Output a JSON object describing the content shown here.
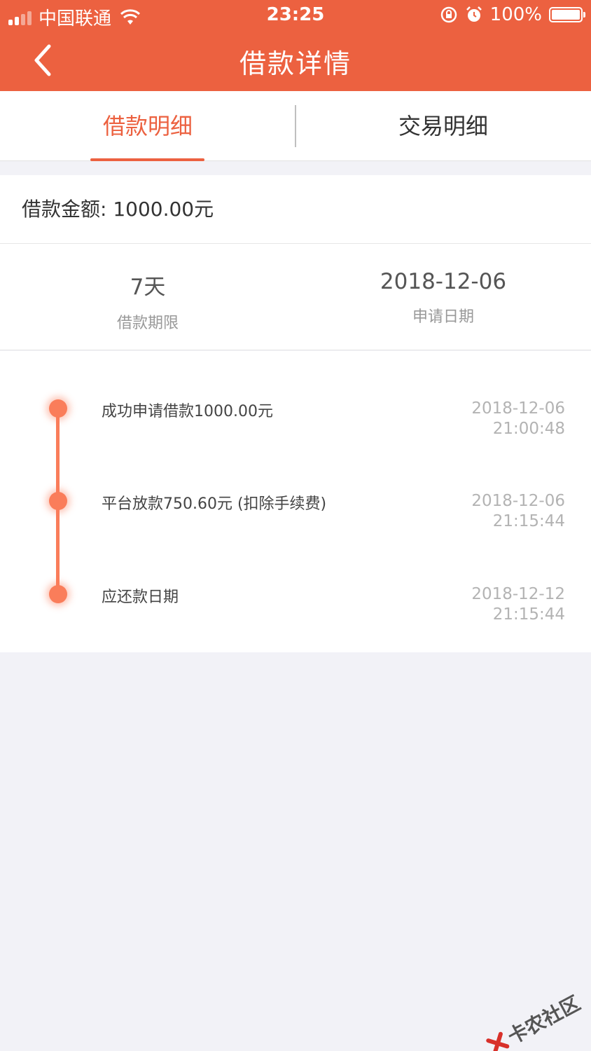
{
  "status_bar": {
    "carrier": "中国联通",
    "time": "23:25",
    "battery": "100%"
  },
  "nav": {
    "title": "借款详情"
  },
  "tabs": [
    {
      "label": "借款明细",
      "active": true
    },
    {
      "label": "交易明细",
      "active": false
    }
  ],
  "loan": {
    "amount_text": "借款金额: 1000.00元"
  },
  "summary": {
    "term_value": "7天",
    "term_label": "借款期限",
    "date_value": "2018-12-06",
    "date_label": "申请日期"
  },
  "timeline": [
    {
      "text": "成功申请借款1000.00元",
      "date": "2018-12-06",
      "time": "21:00:48"
    },
    {
      "text": "平台放款750.60元 (扣除手续费)",
      "date": "2018-12-06",
      "time": "21:15:44"
    },
    {
      "text": "应还款日期",
      "date": "2018-12-12",
      "time": "21:15:44"
    }
  ],
  "watermark": {
    "text": "卡农社区"
  },
  "colors": {
    "brand": "#ec6140",
    "timeline": "#fa7d5a"
  }
}
